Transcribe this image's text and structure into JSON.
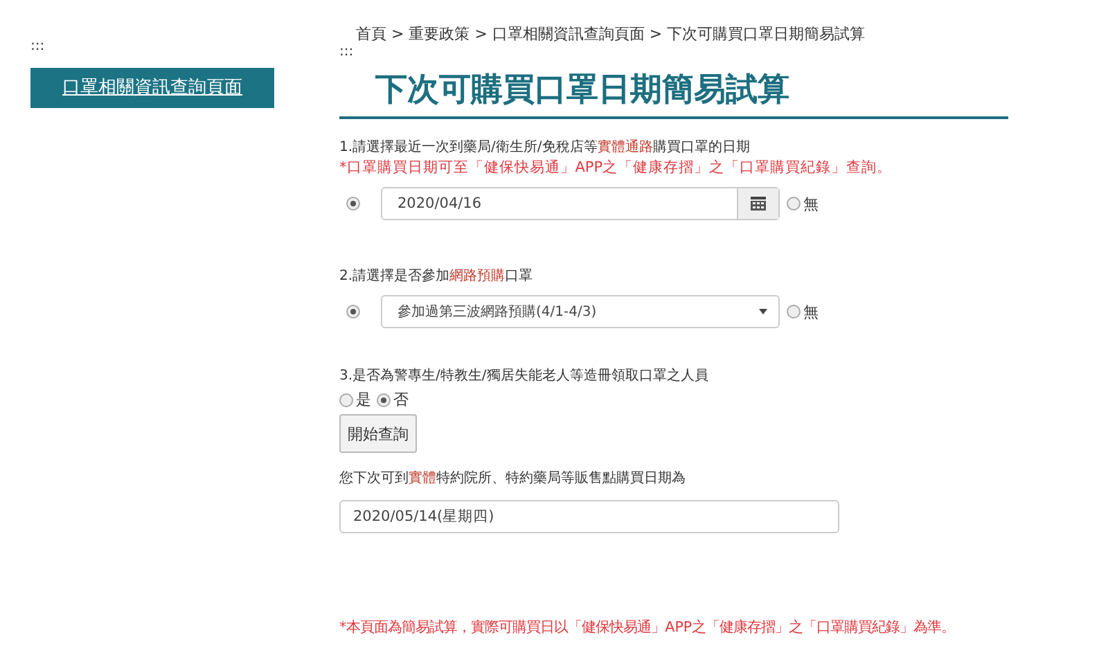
{
  "sidebar": {
    "marker": ":::",
    "link": "口罩相關資訊查詢頁面"
  },
  "breadcrumb": "首頁 > 重要政策 > 口罩相關資訊查詢頁面 > 下次可購買口罩日期簡易試算",
  "content_marker": ":::",
  "title": "下次可購買口罩日期簡易試算",
  "questions": [
    {
      "kind": "date",
      "label": [
        {
          "text": "1.請選擇最近一次到藥局/衛生所/免稅店等",
          "red": false
        },
        {
          "text": "實體通路",
          "red": true
        },
        {
          "text": "購買口罩的日期",
          "red": false
        }
      ],
      "note": "*口罩購買日期可至「健保快易通」APP之「健康存摺」之「口罩購買紀錄」查詢。",
      "value": "2020/04/16",
      "selected": true,
      "none_option": {
        "label": "無",
        "selected": false
      }
    },
    {
      "kind": "select",
      "label": [
        {
          "text": "2.請選擇是否參加",
          "red": false
        },
        {
          "text": "網路預購",
          "red": true
        },
        {
          "text": "口罩",
          "red": false
        }
      ],
      "value": "參加過第三波網路預購(4/1-4/3)",
      "selected": true,
      "none_option": {
        "label": "無",
        "selected": false
      }
    },
    {
      "kind": "choice",
      "label": [
        {
          "text": "3.是否為警專生/特教生/獨居失能老人等造冊領取口罩之人員",
          "red": false
        }
      ],
      "options": [
        {
          "label": "是",
          "selected": false
        },
        {
          "label": "否",
          "selected": true
        }
      ]
    }
  ],
  "submit_button": "開始查詢",
  "result": {
    "label": [
      {
        "text": "您下次可到",
        "red": false
      },
      {
        "text": "實體",
        "red": true
      },
      {
        "text": "特約院所、特約藥局等販售點購買日期為",
        "red": false
      }
    ],
    "value": "2020/05/14(星期四)"
  },
  "footnote": "*本頁面為簡易試算，實際可購買日以「健保快易通」APP之「健康存摺」之「口罩購買紀錄」為準。"
}
